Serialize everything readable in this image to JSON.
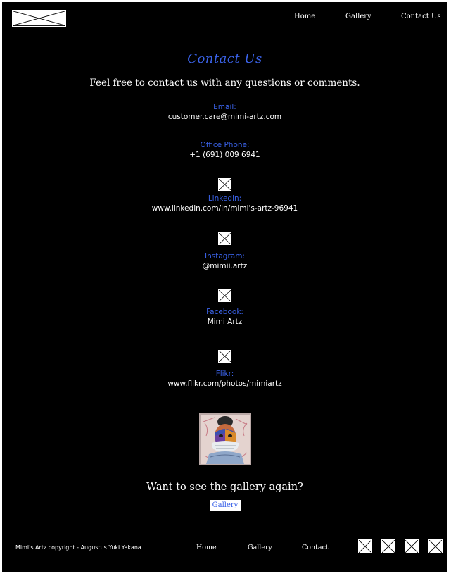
{
  "header": {
    "logo": "logo-placeholder-image",
    "nav": {
      "home": "Home",
      "gallery": "Gallery",
      "contact": "Contact Us"
    }
  },
  "main": {
    "title": "Contact Us",
    "intro": "Feel free to contact us with any questions or comments.",
    "email": {
      "label": "Email:",
      "value": "customer.care@mimi-artz.com"
    },
    "phone": {
      "label": "Office Phone:",
      "value": "+1 (691) 009 6941"
    },
    "linkedin": {
      "label": "Linkedin:",
      "value": "www.linkedin.com/in/mimi's-artz-96941",
      "icon": "linkedin-placeholder-icon"
    },
    "instagram": {
      "label": "Instagram:",
      "value": "@mimii.artz",
      "icon": "instagram-placeholder-icon"
    },
    "facebook": {
      "label": "Facebook:",
      "value": "Mimi Artz",
      "icon": "facebook-placeholder-icon"
    },
    "flikr": {
      "label": "Flikr:",
      "value": "www.flikr.com/photos/mimiartz",
      "icon": "flikr-placeholder-icon"
    },
    "artwork": "portrait-artwork-thumbnail",
    "gallery_prompt": "Want to see the gallery again?",
    "gallery_button": "Gallery"
  },
  "footer": {
    "copyright": "Mimi's Artz copyright - Augustus Yuki Yakana",
    "nav": {
      "home": "Home",
      "gallery": "Gallery",
      "contact": "Contact"
    },
    "social_icons": [
      "social-icon-1",
      "social-icon-2",
      "social-icon-3",
      "social-icon-4"
    ]
  },
  "colors": {
    "background": "#000000",
    "accent": "#3a62e8",
    "text": "#ffffff"
  }
}
